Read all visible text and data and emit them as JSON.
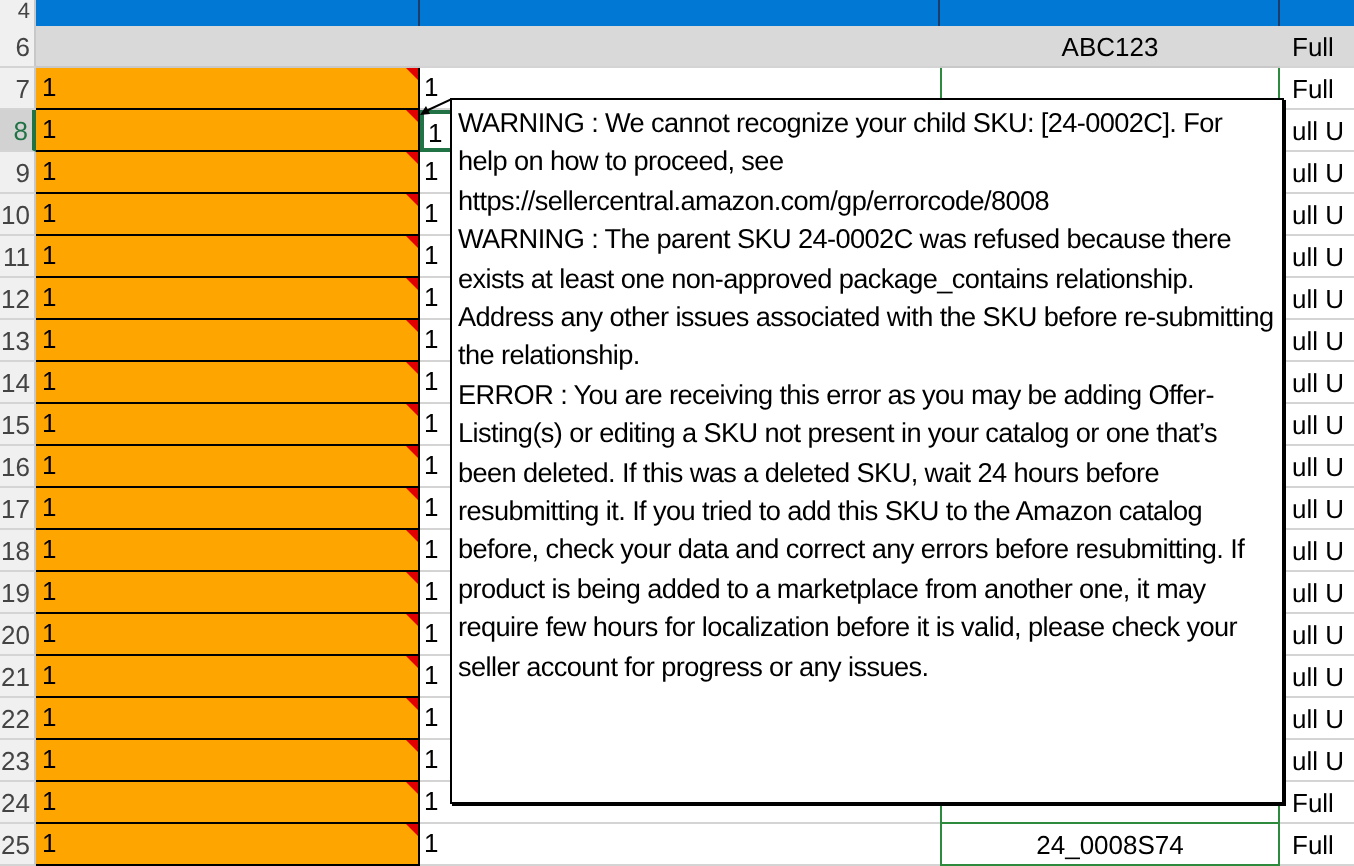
{
  "rows": [
    {
      "kind": "header",
      "num": "4"
    },
    {
      "kind": "band",
      "num": "6",
      "col_c": "ABC123",
      "col_d": "Full"
    },
    {
      "kind": "data",
      "num": "7",
      "col_a": "1",
      "col_b": "1",
      "col_d": "Full",
      "comment": true,
      "selected": false
    },
    {
      "kind": "data",
      "num": "8",
      "col_a": "1",
      "col_b": "1",
      "col_d": "ull U",
      "comment": true,
      "selected": true
    },
    {
      "kind": "data",
      "num": "9",
      "col_a": "1",
      "col_b": "1",
      "col_d": "ull U",
      "comment": true,
      "selected": false
    },
    {
      "kind": "data",
      "num": "10",
      "col_a": "1",
      "col_b": "1",
      "col_d": "ull U",
      "comment": true,
      "selected": false
    },
    {
      "kind": "data",
      "num": "11",
      "col_a": "1",
      "col_b": "1",
      "col_d": "ull U",
      "comment": true,
      "selected": false
    },
    {
      "kind": "data",
      "num": "12",
      "col_a": "1",
      "col_b": "1",
      "col_d": "ull U",
      "comment": true,
      "selected": false
    },
    {
      "kind": "data",
      "num": "13",
      "col_a": "1",
      "col_b": "1",
      "col_d": "ull U",
      "comment": true,
      "selected": false
    },
    {
      "kind": "data",
      "num": "14",
      "col_a": "1",
      "col_b": "1",
      "col_d": "ull U",
      "comment": true,
      "selected": false
    },
    {
      "kind": "data",
      "num": "15",
      "col_a": "1",
      "col_b": "1",
      "col_d": "ull U",
      "comment": true,
      "selected": false
    },
    {
      "kind": "data",
      "num": "16",
      "col_a": "1",
      "col_b": "1",
      "col_d": "ull U",
      "comment": true,
      "selected": false
    },
    {
      "kind": "data",
      "num": "17",
      "col_a": "1",
      "col_b": "1",
      "col_d": "ull U",
      "comment": true,
      "selected": false
    },
    {
      "kind": "data",
      "num": "18",
      "col_a": "1",
      "col_b": "1",
      "col_d": "ull U",
      "comment": true,
      "selected": false
    },
    {
      "kind": "data",
      "num": "19",
      "col_a": "1",
      "col_b": "1",
      "col_d": "ull U",
      "comment": true,
      "selected": false
    },
    {
      "kind": "data",
      "num": "20",
      "col_a": "1",
      "col_b": "1",
      "col_d": "ull U",
      "comment": true,
      "selected": false
    },
    {
      "kind": "data",
      "num": "21",
      "col_a": "1",
      "col_b": "1",
      "col_d": "ull U",
      "comment": true,
      "selected": false
    },
    {
      "kind": "data",
      "num": "22",
      "col_a": "1",
      "col_b": "1",
      "col_d": "ull U",
      "comment": true,
      "selected": false
    },
    {
      "kind": "data",
      "num": "23",
      "col_a": "1",
      "col_b": "1",
      "col_d": "ull U",
      "comment": true,
      "selected": false
    },
    {
      "kind": "data",
      "num": "24",
      "col_a": "1",
      "col_b": "1",
      "col_d": "Full",
      "comment": true,
      "selected": false
    },
    {
      "kind": "data",
      "num": "25",
      "col_a": "1",
      "col_b": "1",
      "col_c": "24_0008S74",
      "col_d": "Full",
      "comment": true,
      "selected": false
    }
  ],
  "comment_popup": {
    "paragraphs": [
      "WARNING : We cannot recognize your child SKU: [24-0002C]. For help on how to proceed, see https://sellercentral.amazon.com/gp/errorcode/8008",
      "WARNING : The parent SKU 24-0002C was refused because there exists at least one non-approved package_contains relationship. Address any other issues associated with the SKU before re-submitting the relationship.",
      "ERROR : You are receiving this error as you may be adding Offer-Listing(s) or editing a SKU not present in your catalog or one that’s been deleted. If this was a deleted SKU, wait 24 hours before resubmitting it. If you tried to add this SKU to the Amazon catalog before, check your data and correct any errors before resubmitting. If product is being added to a marketplace from another one, it may require few hours for localization before it is valid, please check your seller account for progress or any issues."
    ]
  }
}
